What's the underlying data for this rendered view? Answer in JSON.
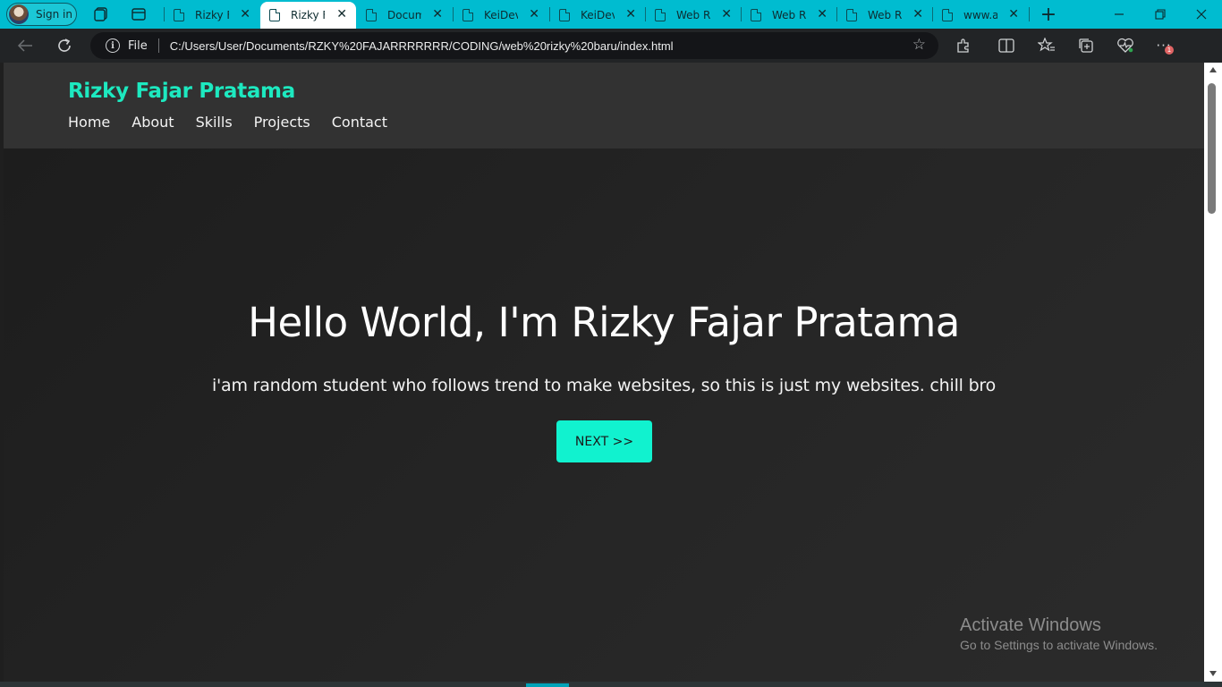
{
  "browser": {
    "signin_label": "Sign in",
    "tabs": [
      {
        "title": "Rizky Fajar Pratama",
        "active": false
      },
      {
        "title": "Rizky Fajar Pratama",
        "active": true
      },
      {
        "title": "Document",
        "active": false
      },
      {
        "title": "KeiDev",
        "active": false
      },
      {
        "title": "KeiDev",
        "active": false
      },
      {
        "title": "Web Rizky",
        "active": false
      },
      {
        "title": "Web Rizky",
        "active": false
      },
      {
        "title": "Web Rizky",
        "active": false
      },
      {
        "title": "www.ad",
        "active": false
      }
    ],
    "address": {
      "scheme_label": "File",
      "url": "C:/Users/User/Documents/RZKY%20FAJARRRRRRR/CODING/web%20rizky%20baru/index.html"
    },
    "notification_count": "1"
  },
  "site": {
    "brand": "Rizky Fajar Pratama",
    "nav": [
      "Home",
      "About",
      "Skills",
      "Projects",
      "Contact"
    ],
    "hero": {
      "title": "Hello World, I'm Rizky Fajar Pratama",
      "subtitle": "i'am random student who follows trend to make websites, so this is just my websites. chill bro",
      "cta_label": "NEXT >>"
    }
  },
  "watermark": {
    "line1": "Activate Windows",
    "line2": "Go to Settings to activate Windows."
  },
  "colors": {
    "tabstrip": "#00bcd0",
    "brand_accent": "#1de9c0",
    "cta_bg": "#11f2cf",
    "page_bg": "#1f1f1f"
  }
}
